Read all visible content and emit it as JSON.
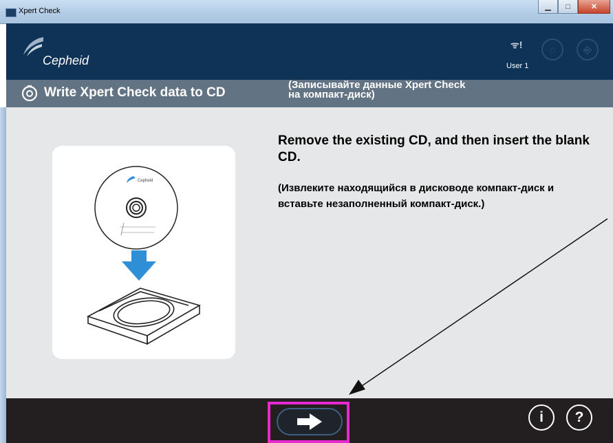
{
  "window": {
    "title": "Xpert Check"
  },
  "header": {
    "logo_text": "Cepheid",
    "user": "User 1"
  },
  "section": {
    "title": "Write Xpert Check data to CD",
    "translation": "(Записывайте данные Xpert Check\nна компакт-диск)"
  },
  "content": {
    "instruction": "Remove the existing CD, and then insert the blank CD.",
    "instruction_translation": "(Извлеките находящийся в дисководе компакт-диск и вставьте незаполненный компакт-диск.)",
    "cd_label": "Cepheid"
  },
  "footer": {
    "info_label": "i",
    "help_label": "?"
  },
  "colors": {
    "header_bg": "#0f3357",
    "section_bg": "#627383",
    "content_bg": "#e6e7e8",
    "footer_bg": "#231f20",
    "highlight": "#e62ad0",
    "arrow_blue": "#2f8fd6"
  }
}
